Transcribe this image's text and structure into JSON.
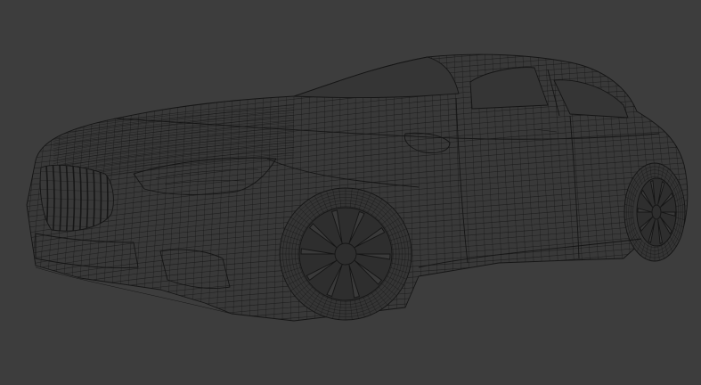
{
  "viewport": {
    "mode": "wireframe",
    "background_color": "#3d3d3d",
    "wire_color": "#151515"
  },
  "scene": {
    "subject": "car",
    "wheels_visible": 2
  }
}
